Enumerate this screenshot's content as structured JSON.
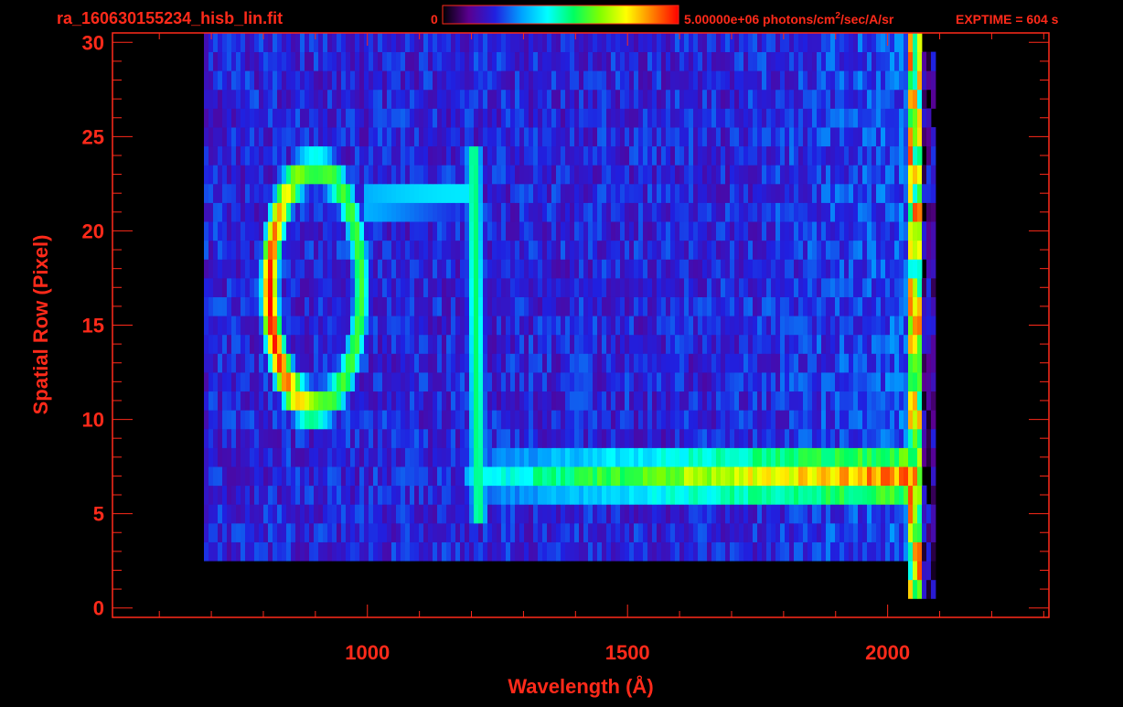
{
  "header": {
    "filename": "ra_160630155234_hisb_lin.fit",
    "colorbar_min": "0",
    "colorbar_max_prefix": "5.00000e+06 photons/cm",
    "colorbar_max_sup": "2",
    "colorbar_max_suffix": "/sec/A/sr",
    "exptime": "EXPTIME = 604 s"
  },
  "colors": {
    "text": "#ff2a1a",
    "background": "#000000",
    "colormap": [
      "#000000",
      "#5a0090",
      "#2020e0",
      "#00a0ff",
      "#00ffff",
      "#00ff60",
      "#80ff00",
      "#ffff00",
      "#ff8000",
      "#ff0000"
    ]
  },
  "chart_data": {
    "type": "heatmap",
    "title": "ra_160630155234_hisb_lin.fit",
    "xlabel": "Wavelength (Å)",
    "ylabel": "Spatial Row (Pixel)",
    "xlim": [
      510,
      2310
    ],
    "ylim": [
      -0.5,
      30.5
    ],
    "x_ticks": [
      {
        "value": 1000,
        "label": "1000"
      },
      {
        "value": 1500,
        "label": "1500"
      },
      {
        "value": 2000,
        "label": "2000"
      }
    ],
    "y_ticks": [
      {
        "value": 0,
        "label": "0"
      },
      {
        "value": 5,
        "label": "5"
      },
      {
        "value": 10,
        "label": "10"
      },
      {
        "value": 15,
        "label": "15"
      },
      {
        "value": 20,
        "label": "20"
      },
      {
        "value": 25,
        "label": "25"
      },
      {
        "value": 30,
        "label": "30"
      }
    ],
    "colorbar": {
      "min": 0,
      "max": 5000000,
      "units": "photons/cm^2/sec/A/sr"
    },
    "features": [
      {
        "name": "ring emission",
        "wavelength_range": [
          790,
          1010
        ],
        "rows": [
          10,
          24
        ],
        "peak_level": 1.0
      },
      {
        "name": "vertical emission line",
        "wavelength": 1216,
        "rows": [
          5,
          24
        ],
        "peak_level": 0.5
      },
      {
        "name": "continuum band",
        "wavelength_range": [
          1190,
          2060
        ],
        "rows": [
          5,
          9
        ],
        "peak_level": 0.95
      },
      {
        "name": "detector edge",
        "wavelength": 2060,
        "rows": [
          1,
          30
        ],
        "peak_level": 1.0
      }
    ]
  }
}
